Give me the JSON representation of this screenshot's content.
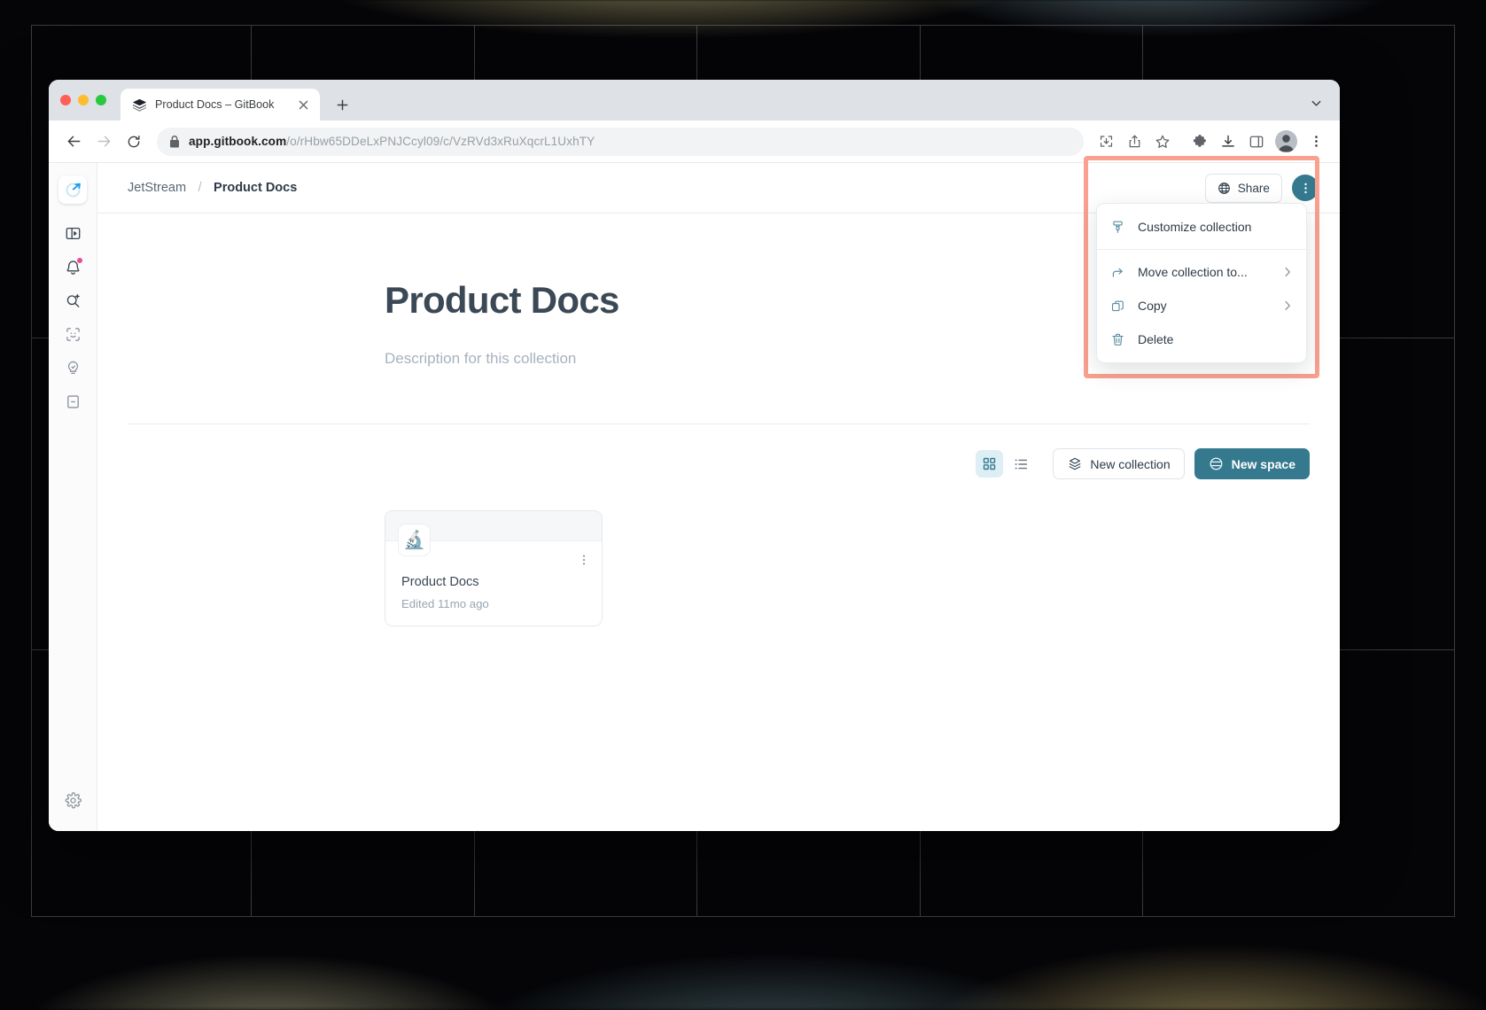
{
  "window": {
    "traffic_lights": [
      "close",
      "minimize",
      "zoom"
    ],
    "tab": {
      "title": "Product Docs – GitBook",
      "favicon": "gitbook-stack-icon",
      "close_label": "×",
      "new_tab_label": "+"
    },
    "tabstrip_right_icon": "chevron-down-icon"
  },
  "browser_toolbar": {
    "back_icon": "back-arrow-icon",
    "forward_icon": "forward-arrow-icon",
    "reload_icon": "reload-icon",
    "lock_icon": "lock-icon",
    "url_domain": "app.gitbook.com",
    "url_path": "/o/rHbw65DDeLxPNJCcyl09/c/VzRVd3xRuXqcrL1UxhTY",
    "url_full": "app.gitbook.com/o/rHbw65DDeLxPNJCcyl09/c/VzRVd3xRuXqcrL1UxhTY",
    "icons": [
      "install-app-icon",
      "share-icon",
      "bookmark-star-icon",
      "extensions-puzzle-icon",
      "downloads-icon",
      "side-panel-icon"
    ],
    "profile_avatar": "user-avatar",
    "menu_icon": "chrome-menu-icon"
  },
  "sidebar": {
    "logo": "jetstream-logo",
    "items": [
      {
        "name": "sidebar-toggle",
        "icon": "panel-toggle-icon",
        "badge": false
      },
      {
        "name": "notifications",
        "icon": "bell-icon",
        "badge": true
      },
      {
        "name": "ai-search",
        "icon": "search-sparkle-icon",
        "badge": false
      },
      {
        "name": "capture",
        "icon": "scan-frame-icon",
        "badge": false
      },
      {
        "name": "insights",
        "icon": "lightbulb-icon",
        "badge": false
      },
      {
        "name": "docs",
        "icon": "book-icon",
        "badge": false
      }
    ],
    "footer": {
      "name": "settings",
      "icon": "gear-icon"
    }
  },
  "topbar": {
    "breadcrumb": {
      "org": "JetStream",
      "separator": "/",
      "current": "Product Docs"
    },
    "share_label": "Share",
    "share_icon": "globe-icon",
    "kebab_icon": "more-vertical-icon"
  },
  "collection": {
    "title": "Product Docs",
    "description_placeholder": "Description for this collection"
  },
  "list_toolbar": {
    "view_modes": [
      {
        "name": "grid-view",
        "icon": "grid-icon",
        "active": true
      },
      {
        "name": "list-view",
        "icon": "list-icon",
        "active": false
      }
    ],
    "new_collection_label": "New collection",
    "new_collection_icon": "collection-icon",
    "new_space_label": "New space",
    "new_space_icon": "space-icon"
  },
  "cards": [
    {
      "emoji": "🔬",
      "title": "Product Docs",
      "meta": "Edited 11mo ago",
      "kebab_icon": "more-vertical-icon"
    }
  ],
  "dropdown_menu": {
    "highlight_color": "#f9a08e",
    "items": [
      {
        "label": "Customize collection",
        "icon": "paint-brush-icon",
        "submenu": false
      },
      {
        "label": "Move collection to...",
        "icon": "move-arrow-icon",
        "submenu": true
      },
      {
        "label": "Copy",
        "icon": "copy-icon",
        "submenu": true
      },
      {
        "label": "Delete",
        "icon": "trash-icon",
        "submenu": false
      }
    ]
  },
  "colors": {
    "accent": "#35798f",
    "menu_icon": "#5b8fa3",
    "highlight": "#f9a08e",
    "text_dark": "#3b4855",
    "text_muted": "#9aa5b1"
  }
}
